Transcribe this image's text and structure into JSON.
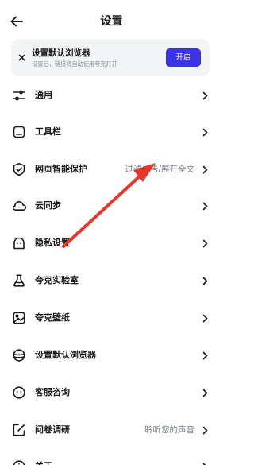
{
  "header": {
    "title": "设置",
    "back_icon": "arrow-left-icon"
  },
  "banner": {
    "title": "设置默认浏览器",
    "subtitle": "设置后，链接将自动使用夸克打开",
    "button_label": "开启",
    "close_icon": "close-icon",
    "accent_color": "#3c32e6"
  },
  "menu": {
    "items": [
      {
        "label": "通用",
        "value": "",
        "icon": "sliders-icon"
      },
      {
        "label": "工具栏",
        "value": "",
        "icon": "toolbar-icon"
      },
      {
        "label": "网页智能保护",
        "value": "过滤广告/展开全文",
        "icon": "shield-check-icon"
      },
      {
        "label": "云同步",
        "value": "",
        "icon": "cloud-icon"
      },
      {
        "label": "隐私设置",
        "value": "",
        "icon": "ghost-icon"
      },
      {
        "label": "夸克实验室",
        "value": "",
        "icon": "flask-icon"
      },
      {
        "label": "夸克壁纸",
        "value": "",
        "icon": "image-icon"
      },
      {
        "label": "设置默认浏览器",
        "value": "",
        "icon": "browser-icon"
      },
      {
        "label": "客服咨询",
        "value": "",
        "icon": "support-icon"
      },
      {
        "label": "问卷调研",
        "value": "聆听您的声音",
        "icon": "survey-icon"
      },
      {
        "label": "关于",
        "value": "",
        "icon": "info-icon"
      }
    ]
  },
  "annotation": {
    "type": "red-arrow",
    "color": "#e8362b"
  }
}
